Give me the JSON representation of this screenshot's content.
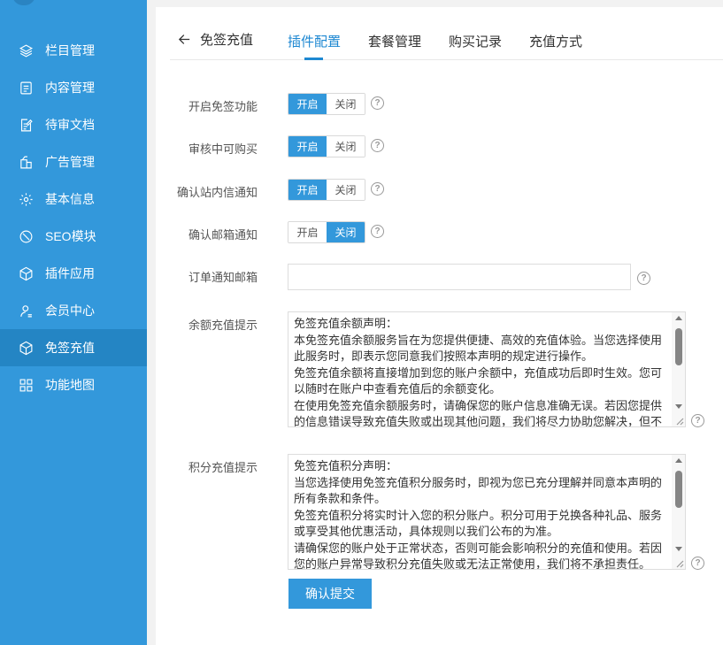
{
  "sidebar": {
    "items": [
      {
        "label": "栏目管理",
        "icon": "layers-icon"
      },
      {
        "label": "内容管理",
        "icon": "document-list-icon"
      },
      {
        "label": "待审文档",
        "icon": "edit-document-icon"
      },
      {
        "label": "广告管理",
        "icon": "ad-icon"
      },
      {
        "label": "基本信息",
        "icon": "gear-icon"
      },
      {
        "label": "SEO模块",
        "icon": "seo-icon"
      },
      {
        "label": "插件应用",
        "icon": "cube-icon"
      },
      {
        "label": "会员中心",
        "icon": "user-icon"
      },
      {
        "label": "免签充值",
        "icon": "cube-icon",
        "active": true
      },
      {
        "label": "功能地图",
        "icon": "grid-icon"
      }
    ]
  },
  "header": {
    "back_label": "免签充值",
    "tabs": [
      {
        "label": "插件配置",
        "active": true
      },
      {
        "label": "套餐管理"
      },
      {
        "label": "购买记录"
      },
      {
        "label": "充值方式"
      }
    ]
  },
  "form": {
    "on_label": "开启",
    "off_label": "关闭",
    "toggles": [
      {
        "label": "开启免签功能",
        "state": "on"
      },
      {
        "label": "审核中可购买",
        "state": "on"
      },
      {
        "label": "确认站内信通知",
        "state": "on"
      },
      {
        "label": "确认邮箱通知",
        "state": "off"
      }
    ],
    "email": {
      "label": "订单通知邮箱",
      "value": ""
    },
    "balance_tip": {
      "label": "余额充值提示",
      "text": "免签充值余额声明：\n本免签充值余额服务旨在为您提供便捷、高效的充值体验。当您选择使用此服务时，即表示您同意我们按照本声明的规定进行操作。\n免签充值余额将直接增加到您的账户余额中，充值成功后即时生效。您可以随时在账户中查看充值后的余额变化。\n在使用免签充值余额服务时，请确保您的账户信息准确无误。若因您提供的信息错误导致充值失败或出现其他问题，我们将尽力协助您解决，但不"
    },
    "points_tip": {
      "label": "积分充值提示",
      "text": "免签充值积分声明：\n当您选择使用免签充值积分服务时，即视为您已充分理解并同意本声明的所有条款和条件。\n免签充值积分将实时计入您的积分账户。积分可用于兑换各种礼品、服务或享受其他优惠活动，具体规则以我们公布的为准。\n请确保您的账户处于正常状态，否则可能会影响积分的充值和使用。若因您的账户异常导致积分充值失败或无法正常使用，我们将不承担责任。"
    },
    "submit_label": "确认提交"
  }
}
